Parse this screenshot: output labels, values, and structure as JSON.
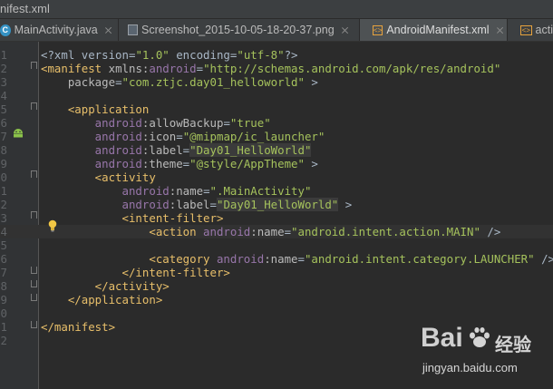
{
  "window": {
    "title": "nifest.xml"
  },
  "tabs": [
    {
      "label": "MainActivity.java",
      "icon": "java-class-icon",
      "active": false
    },
    {
      "label": "Screenshot_2015-10-05-18-20-37.png",
      "icon": "image-file-icon",
      "active": false
    },
    {
      "label": "AndroidManifest.xml",
      "icon": "xml-file-icon",
      "active": true
    },
    {
      "label": "acti",
      "icon": "xml-file-icon",
      "active": false
    }
  ],
  "editor": {
    "line_numbers": [
      "1",
      "2",
      "3",
      "4",
      "5",
      "6",
      "7",
      "8",
      "9",
      "0",
      "1",
      "2",
      "3",
      "4",
      "5",
      "6",
      "7",
      "8",
      "9",
      "0",
      "1",
      "2"
    ],
    "lines": [
      [
        [
          "plain",
          "<?xml version="
        ],
        [
          "val",
          "\"1.0\""
        ],
        [
          "plain",
          " encoding="
        ],
        [
          "val",
          "\"utf-8\""
        ],
        [
          "plain",
          "?>"
        ]
      ],
      [
        [
          "tag",
          "<manifest "
        ],
        [
          "attr",
          "xmlns:"
        ],
        [
          "ns",
          "android"
        ],
        [
          "plain",
          "="
        ],
        [
          "val",
          "\"http://schemas.android.com/apk/res/android\""
        ]
      ],
      [
        [
          "attr",
          "    package"
        ],
        [
          "plain",
          "="
        ],
        [
          "val",
          "\"com.ztjc.day01_helloworld\""
        ],
        [
          "plain",
          " >"
        ]
      ],
      [],
      [
        [
          "tag",
          "    <application"
        ]
      ],
      [
        [
          "ns",
          "        android"
        ],
        [
          "attr",
          ":allowBackup"
        ],
        [
          "plain",
          "="
        ],
        [
          "val",
          "\"true\""
        ]
      ],
      [
        [
          "ns",
          "        android"
        ],
        [
          "attr",
          ":icon"
        ],
        [
          "plain",
          "="
        ],
        [
          "val",
          "\"@mipmap/ic_launcher\""
        ]
      ],
      [
        [
          "ns",
          "        android"
        ],
        [
          "attr",
          ":label"
        ],
        [
          "plain",
          "="
        ],
        [
          "val-hl",
          "\"Day01_HelloWorld\""
        ]
      ],
      [
        [
          "ns",
          "        android"
        ],
        [
          "attr",
          ":theme"
        ],
        [
          "plain",
          "="
        ],
        [
          "val",
          "\"@style/AppTheme\""
        ],
        [
          "plain",
          " >"
        ]
      ],
      [
        [
          "tag",
          "        <activity"
        ]
      ],
      [
        [
          "ns",
          "            android"
        ],
        [
          "attr",
          ":name"
        ],
        [
          "plain",
          "="
        ],
        [
          "val",
          "\".MainActivity\""
        ]
      ],
      [
        [
          "ns",
          "            android"
        ],
        [
          "attr",
          ":label"
        ],
        [
          "plain",
          "="
        ],
        [
          "val-hl",
          "\"Day01_HelloWorld\""
        ],
        [
          "plain",
          " >"
        ]
      ],
      [
        [
          "tag",
          "            <intent-filter"
        ],
        [
          "tag",
          ">"
        ]
      ],
      [
        [
          "tag",
          "                <action "
        ],
        [
          "ns",
          "android"
        ],
        [
          "attr",
          ":name"
        ],
        [
          "plain",
          "="
        ],
        [
          "val",
          "\"android.intent.action.MAIN\""
        ],
        [
          "plain",
          " />"
        ]
      ],
      [],
      [
        [
          "tag",
          "                <category "
        ],
        [
          "ns",
          "android"
        ],
        [
          "attr",
          ":name"
        ],
        [
          "plain",
          "="
        ],
        [
          "val",
          "\"android.intent.category.LAUNCHER\""
        ],
        [
          "plain",
          " />"
        ]
      ],
      [
        [
          "tag",
          "            </intent-filter>"
        ]
      ],
      [
        [
          "tag",
          "        </activity>"
        ]
      ],
      [
        [
          "tag",
          "    </application>"
        ]
      ],
      [],
      [
        [
          "tag",
          "</manifest>"
        ]
      ],
      []
    ]
  },
  "watermark": {
    "logo": "Bai",
    "logo_cn": "经验",
    "url": "jingyan.baidu.com"
  }
}
